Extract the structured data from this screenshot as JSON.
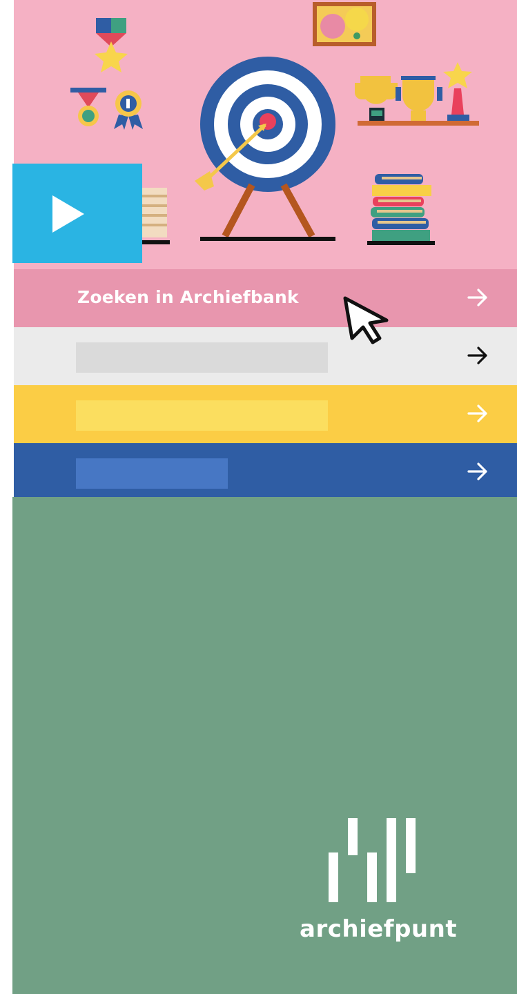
{
  "hero": {
    "play_icon": "play-icon",
    "background": "#f5b1c4"
  },
  "menu": {
    "items": [
      {
        "label": "Zoeken in Archiefbank",
        "bg": "#e896ae",
        "arrow_color": "#ffffff",
        "arrow_icon": "arrow-right-icon"
      },
      {
        "label": "",
        "bg": "#ebebeb",
        "bar_color": "#dadada",
        "arrow_color": "#111111",
        "arrow_icon": "arrow-right-icon"
      },
      {
        "label": "",
        "bg": "#fbcd45",
        "bar_color": "#fbde5f",
        "arrow_color": "#ffffff",
        "arrow_icon": "arrow-right-icon"
      },
      {
        "label": "",
        "bg": "#2f5da4",
        "bar_color": "#4777c4",
        "arrow_color": "#ffffff",
        "arrow_icon": "arrow-right-icon"
      }
    ]
  },
  "cursor_icon": "mouse-pointer-icon",
  "footer": {
    "logo_text": "archiefpunt",
    "background": "#71a085"
  }
}
